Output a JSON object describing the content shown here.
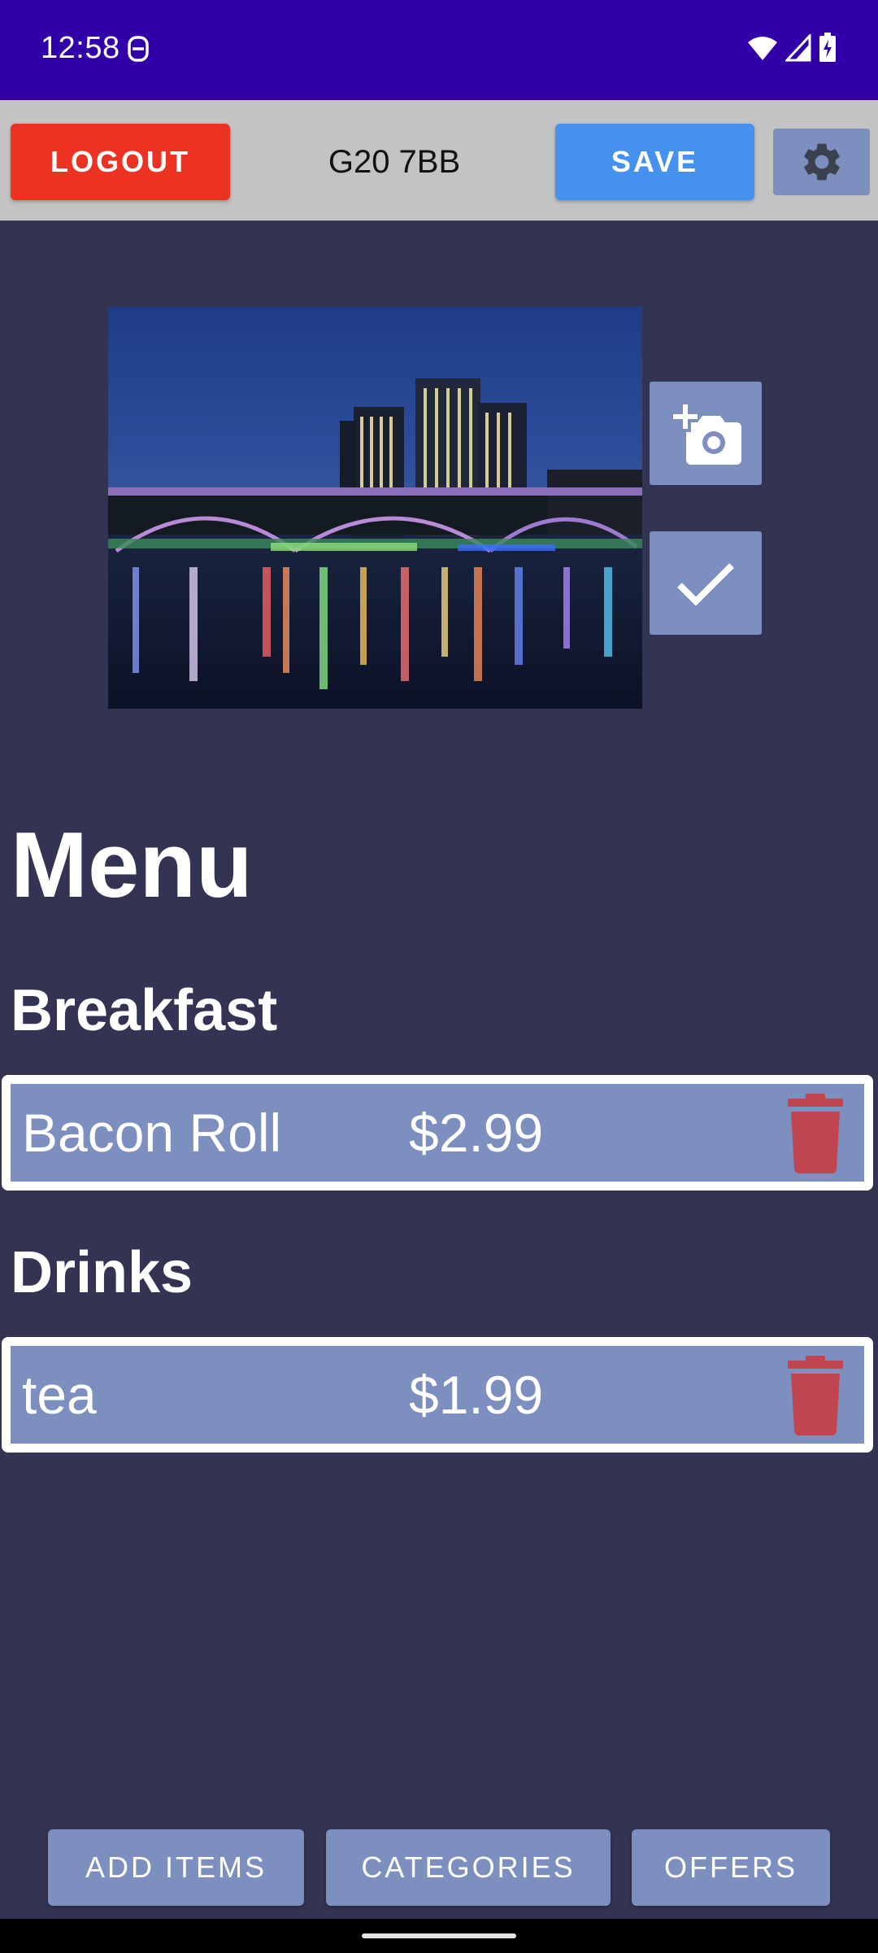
{
  "status_bar": {
    "time": "12:58",
    "icons": [
      "vpn-key-icon",
      "wifi-icon",
      "signal-icon",
      "battery-charging-icon"
    ],
    "background": "#3200A8"
  },
  "toolbar": {
    "logout_label": "LOGOUT",
    "postcode": "G20 7BB",
    "save_label": "SAVE",
    "settings_icon": "gear-icon",
    "colors": {
      "logout": "#EB3223",
      "save": "#4690EE",
      "settings": "#7C8FBE",
      "bar": "#C3C3C3"
    }
  },
  "photo": {
    "subject_icon": "night-bridge-photo"
  },
  "side_buttons": {
    "camera_icon": "add-camera-icon",
    "check_icon": "check-icon"
  },
  "menu": {
    "title": "Menu",
    "categories": [
      {
        "name": "Breakfast",
        "items": [
          {
            "name": "Bacon Roll",
            "price": "$2.99",
            "action_icon": "trash-icon"
          }
        ]
      },
      {
        "name": "Drinks",
        "items": [
          {
            "name": "tea",
            "price": "$1.99",
            "action_icon": "trash-icon"
          }
        ]
      }
    ]
  },
  "bottom_nav": {
    "add_items_label": "ADD ITEMS",
    "categories_label": "CATEGORIES",
    "offers_label": "OFFERS"
  },
  "colors": {
    "background": "#333354",
    "item_bg": "#7C8FBE",
    "trash": "#C1454F"
  }
}
